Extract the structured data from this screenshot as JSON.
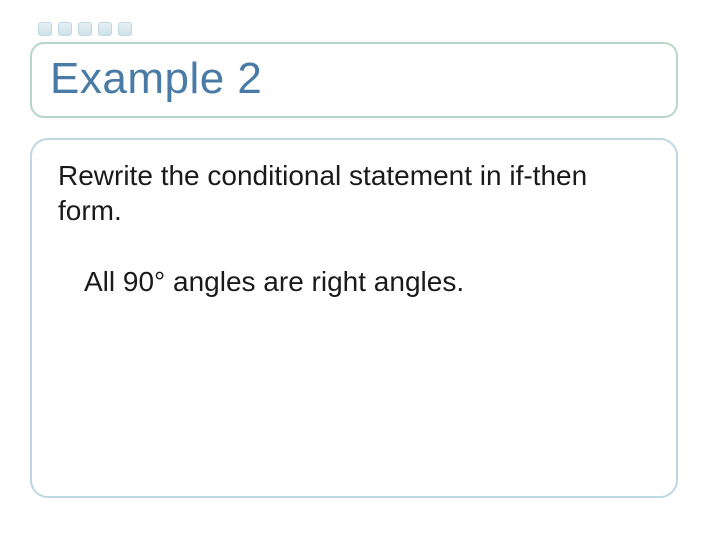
{
  "slide": {
    "title": "Example 2",
    "instruction": "Rewrite the conditional statement in if-then form.",
    "statement": "All 90° angles are right angles."
  }
}
